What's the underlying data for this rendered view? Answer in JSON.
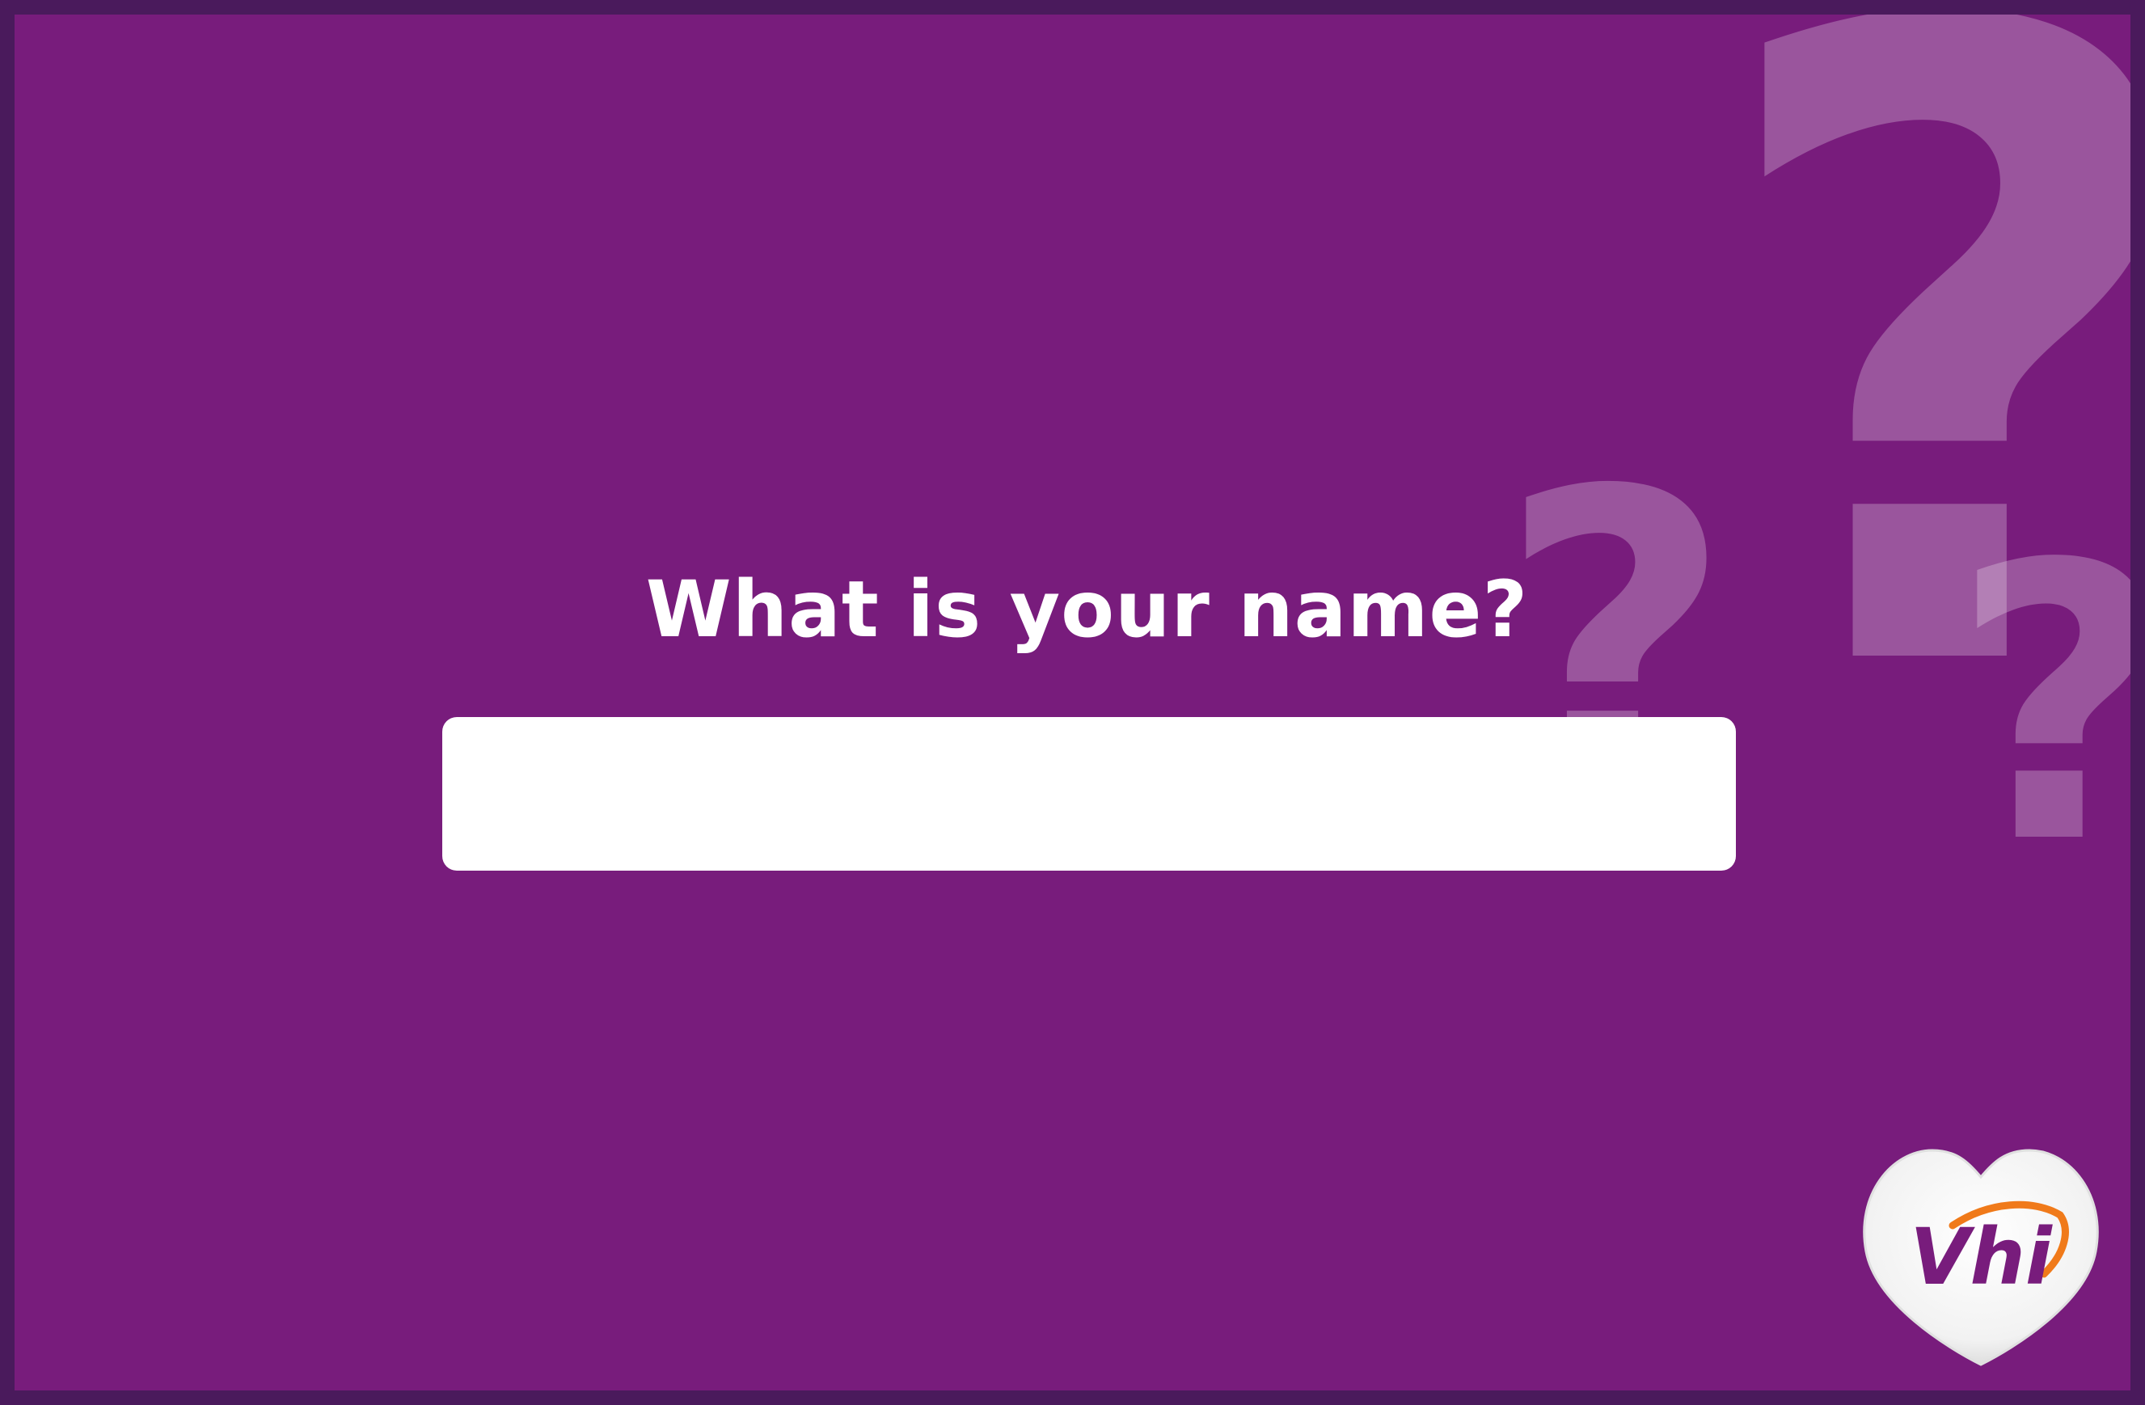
{
  "screen": {
    "question": "What is your name?",
    "background_color": "#781c7c",
    "border_color": "#4a1a5c",
    "accent_color": "#f07a1a"
  },
  "name_input": {
    "value": "",
    "placeholder": ""
  },
  "decorations": {
    "question_mark_glyph": "?",
    "icons": [
      "question-mark-icon",
      "question-mark-icon",
      "question-mark-icon"
    ]
  },
  "logo": {
    "text": "Vhi",
    "icon": "heart-logo-icon"
  }
}
